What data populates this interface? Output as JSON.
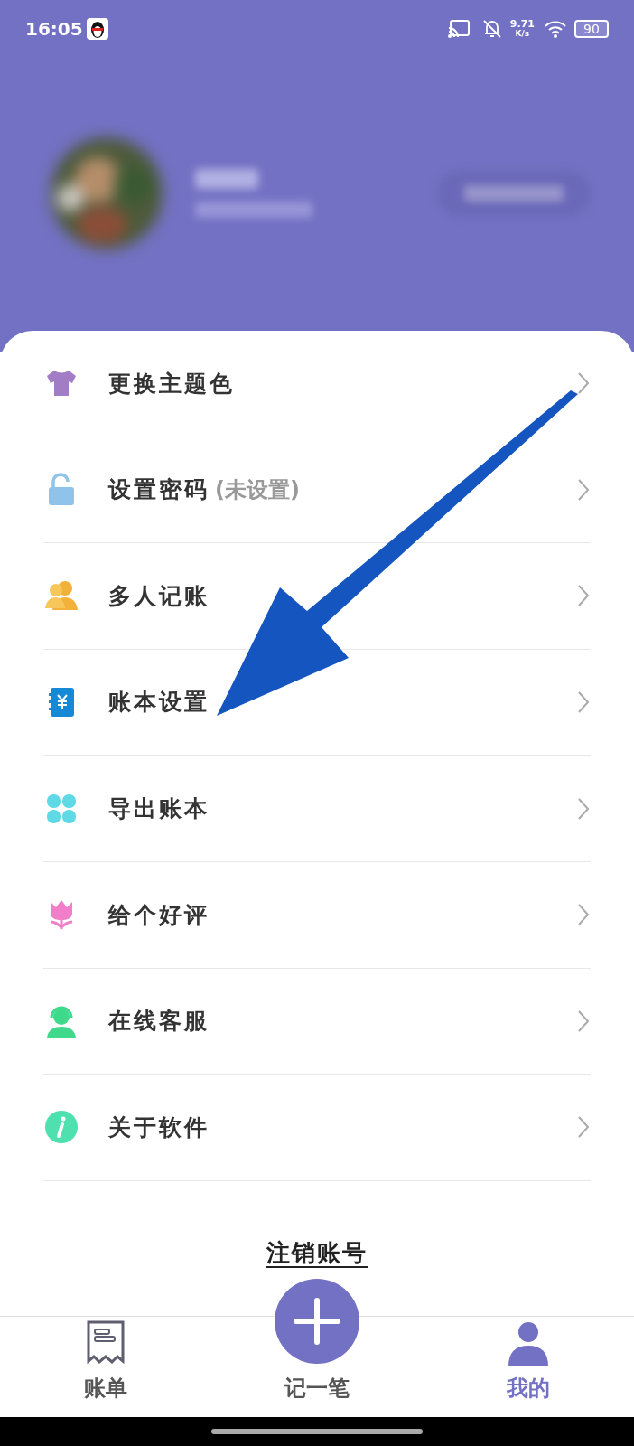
{
  "status_bar": {
    "time": "16:05",
    "speed_value": "9.71",
    "speed_unit": "K/s",
    "battery": "90"
  },
  "menu": [
    {
      "kind": "shirt",
      "label": "更换主题色"
    },
    {
      "kind": "lock",
      "label": "设置密码",
      "note": "(未设置)"
    },
    {
      "kind": "people",
      "label": "多人记账"
    },
    {
      "kind": "book",
      "label": "账本设置"
    },
    {
      "kind": "clover",
      "label": "导出账本"
    },
    {
      "kind": "flower",
      "label": "给个好评"
    },
    {
      "kind": "agent",
      "label": "在线客服"
    },
    {
      "kind": "info",
      "label": "关于软件"
    }
  ],
  "logout": "注销账号",
  "tabs": [
    {
      "kind": "bill",
      "label": "账单",
      "selected": false
    },
    {
      "kind": "add",
      "label": "记一笔",
      "selected": false
    },
    {
      "kind": "me",
      "label": "我的",
      "selected": true
    }
  ]
}
